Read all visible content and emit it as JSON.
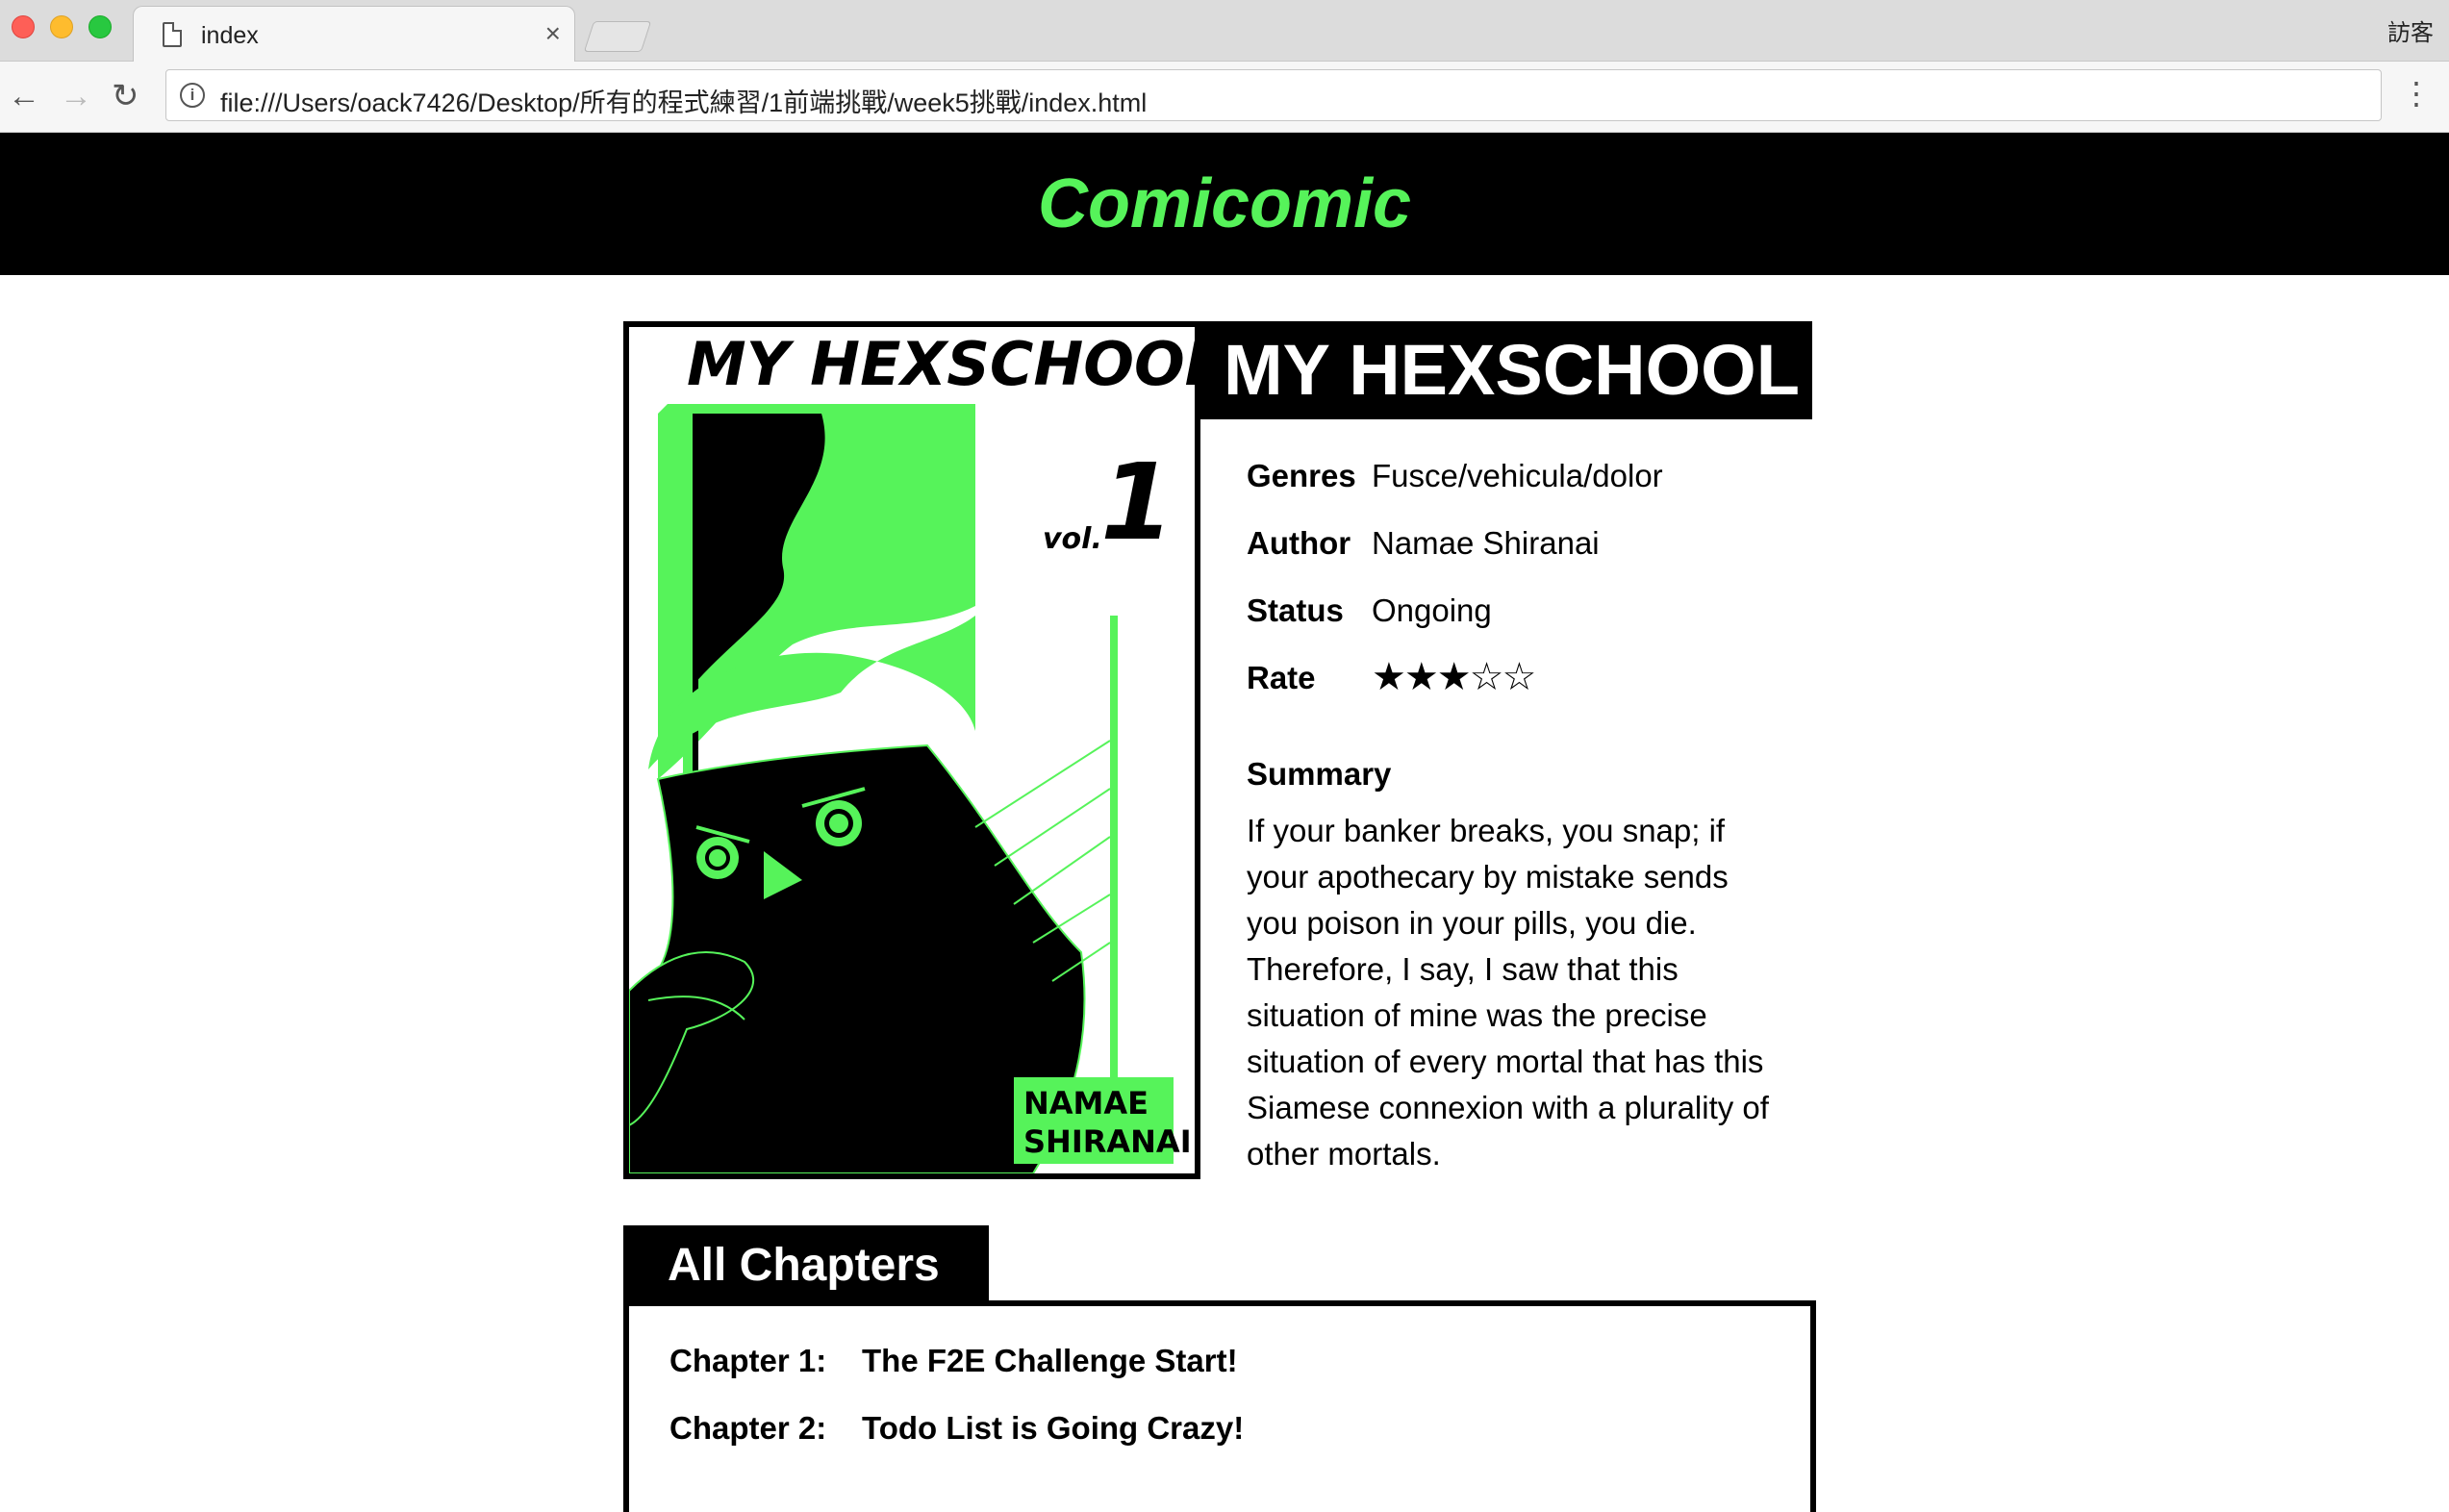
{
  "browser": {
    "tab_title": "index",
    "tab_close": "×",
    "profile": "訪客",
    "url": "file:///Users/oack7426/Desktop/所有的程式練習/1前端挑戰/week5挑戰/index.html",
    "nav": {
      "back": "←",
      "forward": "→",
      "reload": "↻"
    },
    "info_icon": "i",
    "menu": "⋮"
  },
  "site": {
    "logo": "Comicomic"
  },
  "comic": {
    "cover": {
      "series_title": "MY HEXSCHOOL",
      "vol_label": "vol.",
      "vol_number": "1",
      "author_line1": "NAMAE",
      "author_line2": "SHIRANAI",
      "colors": {
        "accent": "#56f35a",
        "ink": "#000000"
      }
    },
    "title": "MY HEXSCHOOL",
    "info": {
      "genres_label": "Genres",
      "genres": "Fusce/vehicula/dolor",
      "author_label": "Author",
      "author": "Namae Shiranai",
      "status_label": "Status",
      "status": "Ongoing",
      "rate_label": "Rate",
      "rate_stars": "★★★☆☆",
      "rating": 3,
      "rating_max": 5
    },
    "summary_label": "Summary",
    "summary": "If your banker breaks, you snap; if your apothecary by mistake sends you poison in your pills, you die. Therefore, I say, I saw that this situation of mine was the precise situation of every mortal that has this Siamese connexion with a plurality of other mortals."
  },
  "chapters": {
    "heading": "All Chapters",
    "items": [
      {
        "number": "Chapter 1:",
        "title": "The F2E Challenge Start!"
      },
      {
        "number": "Chapter 2:",
        "title": "Todo List is Going Crazy!"
      }
    ]
  },
  "icons": {
    "tab_page": "document-icon",
    "info": "info-icon",
    "star_full": "star-filled-icon",
    "star_empty": "star-empty-icon"
  }
}
